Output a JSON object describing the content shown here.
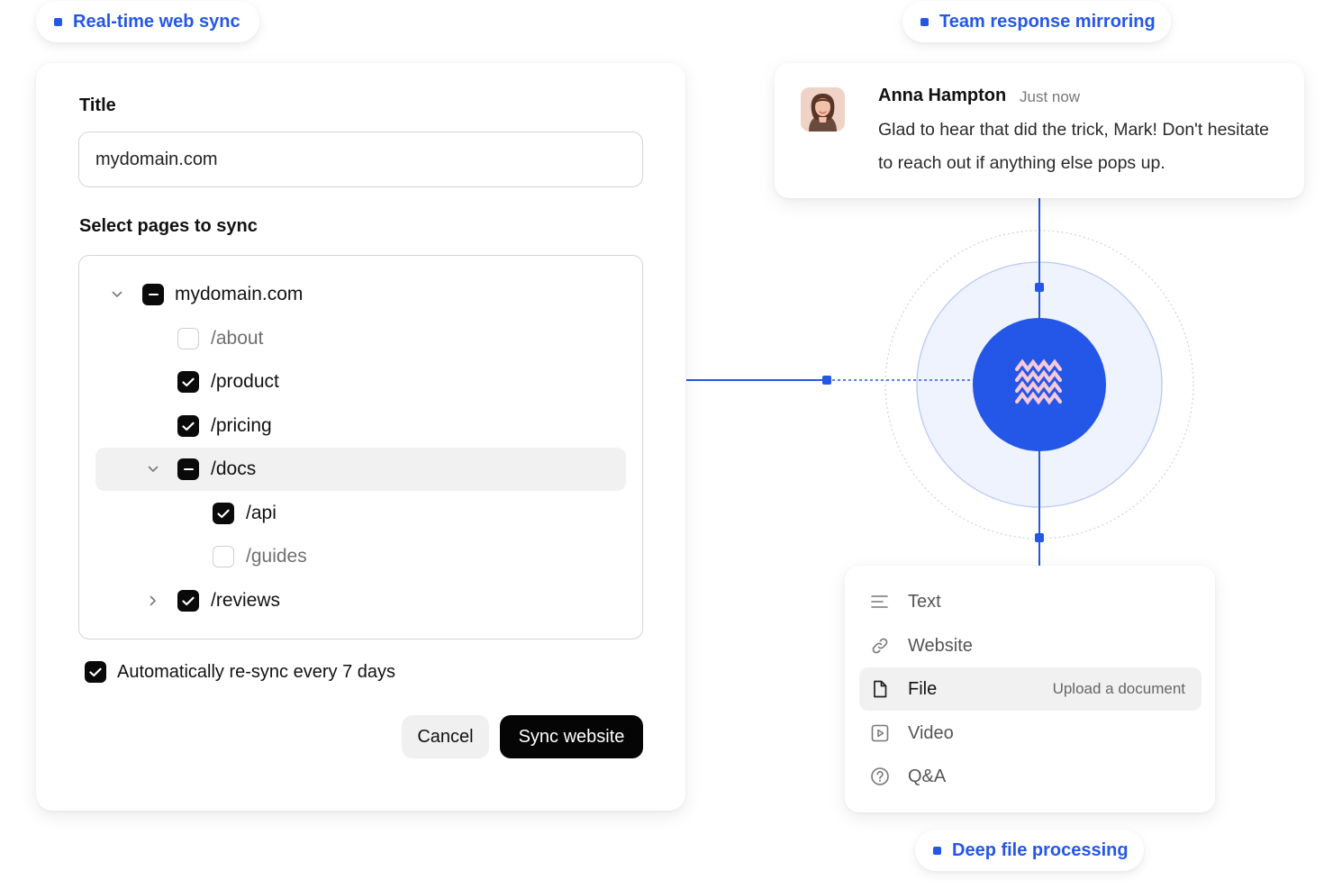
{
  "pills": {
    "sync": "Real-time web sync",
    "team": "Team response mirroring",
    "deep": "Deep file processing"
  },
  "sync_form": {
    "title_label": "Title",
    "title_value": "mydomain.com",
    "select_label": "Select pages to sync",
    "tree": [
      {
        "label": "mydomain.com",
        "state": "indeterminate",
        "chevron": "down"
      },
      {
        "label": "/about",
        "state": "unchecked"
      },
      {
        "label": "/product",
        "state": "checked"
      },
      {
        "label": "/pricing",
        "state": "checked"
      },
      {
        "label": "/docs",
        "state": "indeterminate",
        "chevron": "down"
      },
      {
        "label": "/api",
        "state": "checked"
      },
      {
        "label": "/guides",
        "state": "unchecked"
      },
      {
        "label": "/reviews",
        "state": "checked",
        "chevron": "right"
      }
    ],
    "auto_resync_label": "Automatically re-sync every 7 days",
    "auto_resync_checked": true,
    "cancel_label": "Cancel",
    "submit_label": "Sync website"
  },
  "chat": {
    "name": "Anna Hampton",
    "time": "Just now",
    "message": "Glad to hear that did the trick, Mark! Don't hesitate to reach out if anything else pops up."
  },
  "source_menu": {
    "items": [
      {
        "label": "Text",
        "icon": "text-lines-icon"
      },
      {
        "label": "Website",
        "icon": "link-icon"
      },
      {
        "label": "File",
        "icon": "file-icon",
        "hint": "Upload a document",
        "active": true
      },
      {
        "label": "Video",
        "icon": "video-icon"
      },
      {
        "label": "Q&A",
        "icon": "question-circle-icon"
      }
    ]
  },
  "colors": {
    "accent": "#2457e8",
    "hub_fill": "#2457e8",
    "ring_fill": "#eef3fd",
    "checkbox": "#0a0a0a"
  }
}
